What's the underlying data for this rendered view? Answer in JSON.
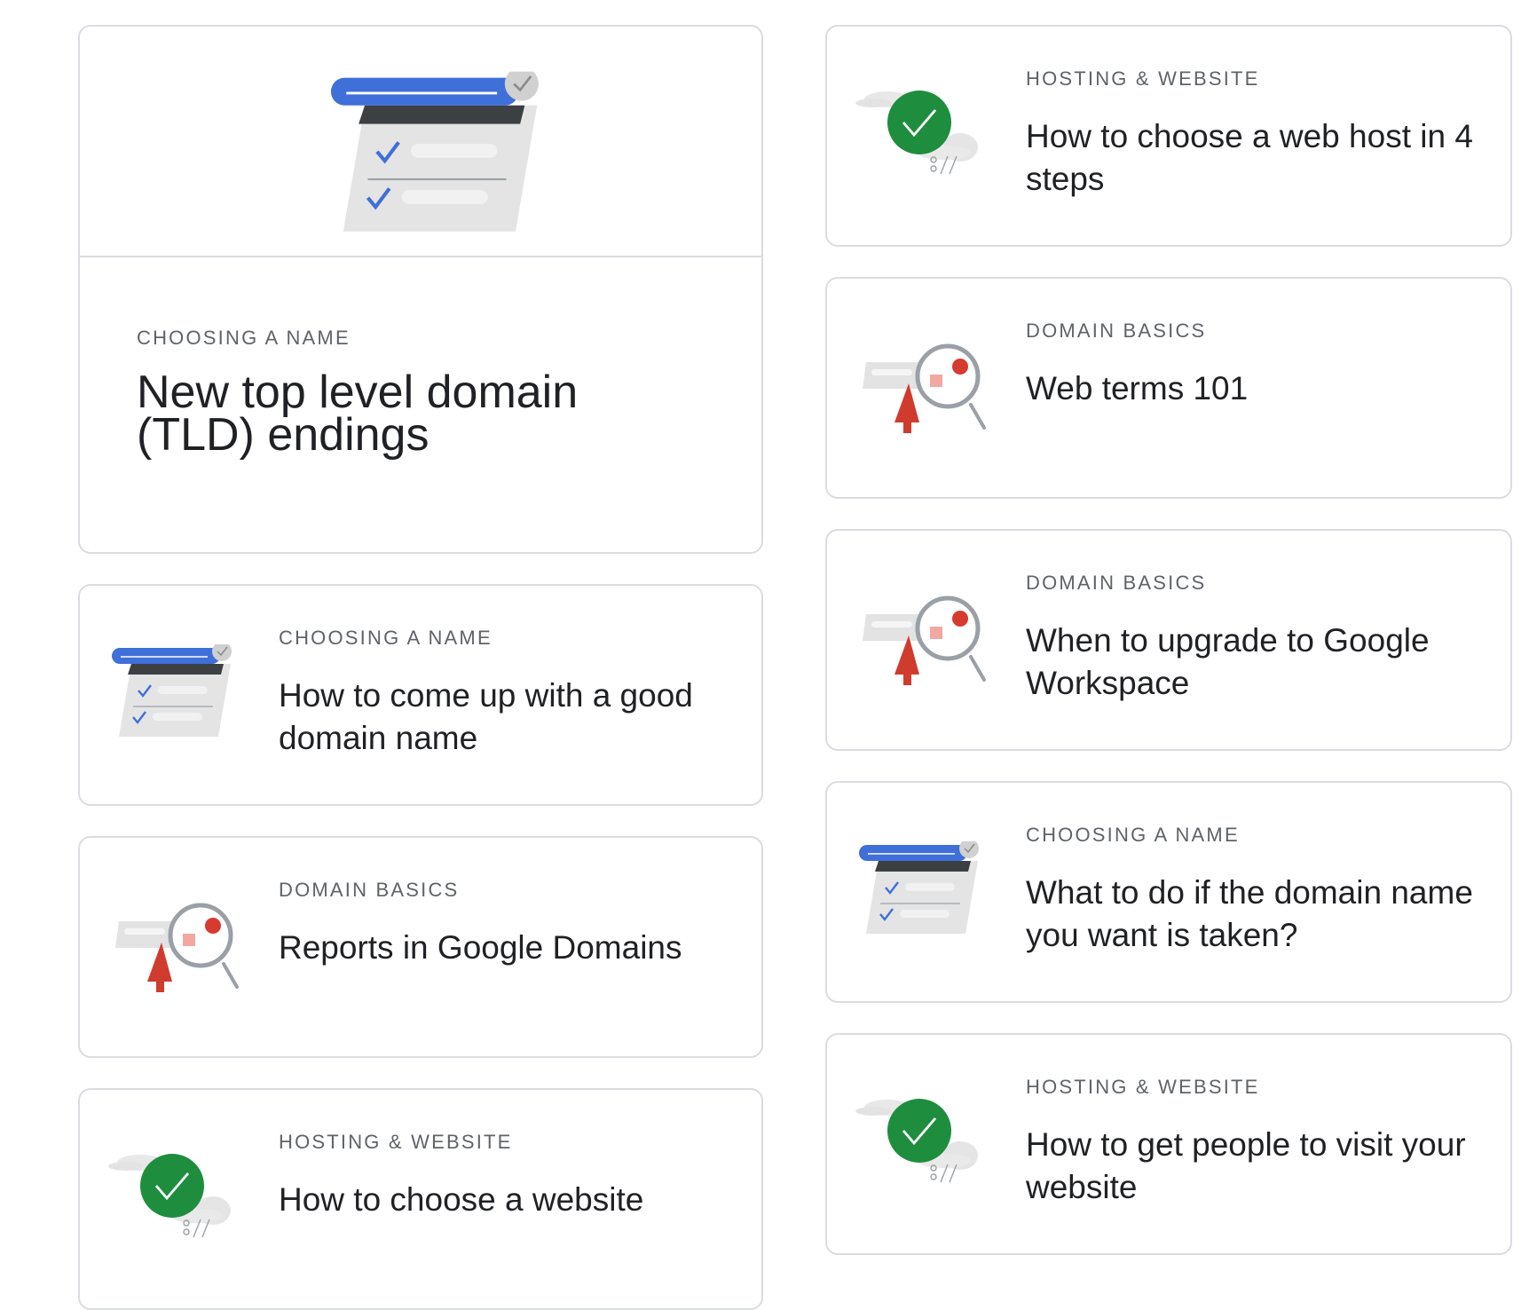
{
  "cards": [
    {
      "category": "Choosing a name",
      "title": "New top level domain (TLD) endings",
      "icon": "checklist-illustration-icon"
    },
    {
      "category": "Choosing a name",
      "title": "How to come up with a good domain name",
      "icon": "checklist-illustration-icon"
    },
    {
      "category": "Domain basics",
      "title": "Reports in Google Domains",
      "icon": "magnifier-illustration-icon"
    },
    {
      "category": "Hosting & website",
      "title": "How to choose a website",
      "icon": "cloud-check-illustration-icon"
    },
    {
      "category": "Hosting & website",
      "title": "How to choose a web host in 4 steps",
      "icon": "cloud-check-illustration-icon"
    },
    {
      "category": "Domain basics",
      "title": "Web terms 101",
      "icon": "magnifier-illustration-icon"
    },
    {
      "category": "Domain basics",
      "title": "When to upgrade to Google Workspace",
      "icon": "magnifier-illustration-icon"
    },
    {
      "category": "Choosing a name",
      "title": "What to do if the domain name you want is taken?",
      "icon": "checklist-illustration-icon"
    },
    {
      "category": "Hosting & website",
      "title": "How to get people to visit your website",
      "icon": "cloud-check-illustration-icon"
    }
  ],
  "colors": {
    "blue": "#4285f4",
    "green": "#34a853",
    "red": "#ea4335",
    "gray_light": "#e8eaed",
    "border": "#dadce0"
  }
}
